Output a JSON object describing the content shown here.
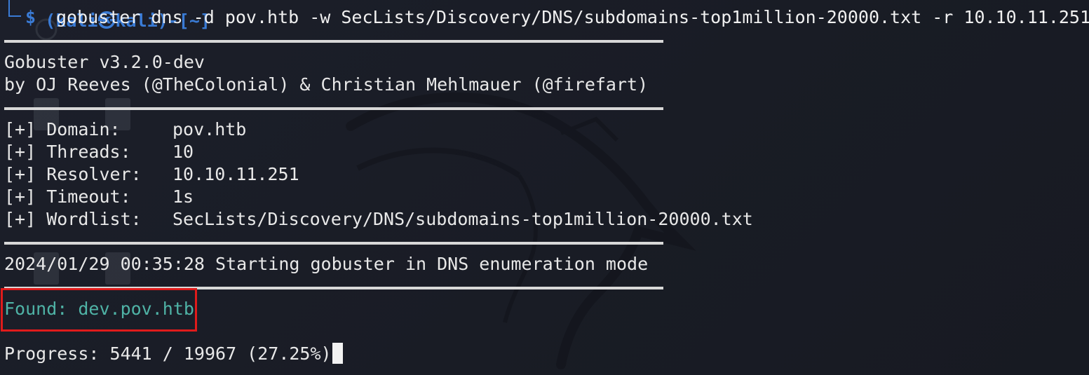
{
  "terminal": {
    "prompt": {
      "partial_user_line": "(kali㉿kali)-[~]",
      "symbol": "$",
      "command": "gobuster dns -d pov.htb -w SecLists/Discovery/DNS/subdomains-top1million-20000.txt -r 10.10.11.251"
    },
    "banner": {
      "title": "Gobuster v3.2.0-dev",
      "authors": "by OJ Reeves (@TheColonial) & Christian Mehlmauer (@firefart)"
    },
    "options": [
      {
        "label": "[+] Domain:",
        "value": "pov.htb"
      },
      {
        "label": "[+] Threads:",
        "value": "10"
      },
      {
        "label": "[+] Resolver:",
        "value": "10.10.11.251"
      },
      {
        "label": "[+] Timeout:",
        "value": "1s"
      },
      {
        "label": "[+] Wordlist:",
        "value": "SecLists/Discovery/DNS/subdomains-top1million-20000.txt"
      }
    ],
    "start_message": "2024/01/29 00:35:28 Starting gobuster in DNS enumeration mode",
    "found": "Found: dev.pov.htb",
    "progress": "Progress: 5441 / 19967 (27.25%)"
  },
  "colors": {
    "background": "#1a1d26",
    "prompt_blue": "#3a7bd5",
    "found_teal": "#4fb3a6",
    "highlight_red": "#e01b1b",
    "text": "#e8e8e8"
  }
}
